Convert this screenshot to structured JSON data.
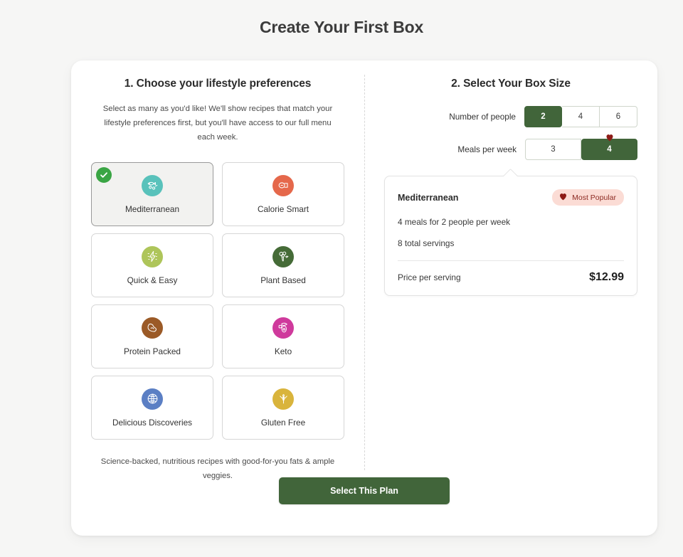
{
  "page": {
    "title": "Create Your First Box"
  },
  "left": {
    "heading": "1. Choose your lifestyle preferences",
    "subtext": "Select as many as you'd like! We'll show recipes that match your lifestyle preferences first, but you'll have access to our full menu each week.",
    "footnote": "Science-backed, nutritious recipes with good-for-you fats & ample veggies.",
    "preferences": [
      {
        "label": "Mediterranean",
        "icon": "fish-icon",
        "color": "#59c2bb",
        "selected": true
      },
      {
        "label": "Calorie Smart",
        "icon": "measure-icon",
        "color": "#e5684b",
        "selected": false
      },
      {
        "label": "Quick & Easy",
        "icon": "lightning-icon",
        "color": "#aec55a",
        "selected": false
      },
      {
        "label": "Plant Based",
        "icon": "broccoli-icon",
        "color": "#456b37",
        "selected": false
      },
      {
        "label": "Protein Packed",
        "icon": "muscle-icon",
        "color": "#9b5a27",
        "selected": false
      },
      {
        "label": "Keto",
        "icon": "avocado-icon",
        "color": "#cf3a9c",
        "selected": false
      },
      {
        "label": "Delicious Discoveries",
        "icon": "globe-icon",
        "color": "#5b7fc4",
        "selected": false
      },
      {
        "label": "Gluten Free",
        "icon": "wheat-icon",
        "color": "#d9b43c",
        "selected": false
      }
    ],
    "check_badge_icon": "check-icon"
  },
  "right": {
    "heading": "2. Select Your Box Size",
    "people": {
      "label": "Number of people",
      "options": [
        "2",
        "4",
        "6"
      ],
      "selected": "2"
    },
    "meals": {
      "label": "Meals per week",
      "options": [
        "3",
        "4"
      ],
      "selected": "4",
      "marker_icon": "heart-icon"
    },
    "summary": {
      "title": "Mediterranean",
      "badge_label": "Most Popular",
      "badge_icon": "heart-icon",
      "line1": "4 meals for 2 people per week",
      "line2": "8 total servings",
      "price_label": "Price per serving",
      "price_value": "$12.99"
    }
  },
  "cta": {
    "label": "Select This Plan"
  },
  "colors": {
    "brand_green": "#41653a",
    "check_green": "#3aa544",
    "badge_bg": "#fbdcd5",
    "badge_text": "#8d2b23",
    "page_bg": "#f6f6f5"
  }
}
